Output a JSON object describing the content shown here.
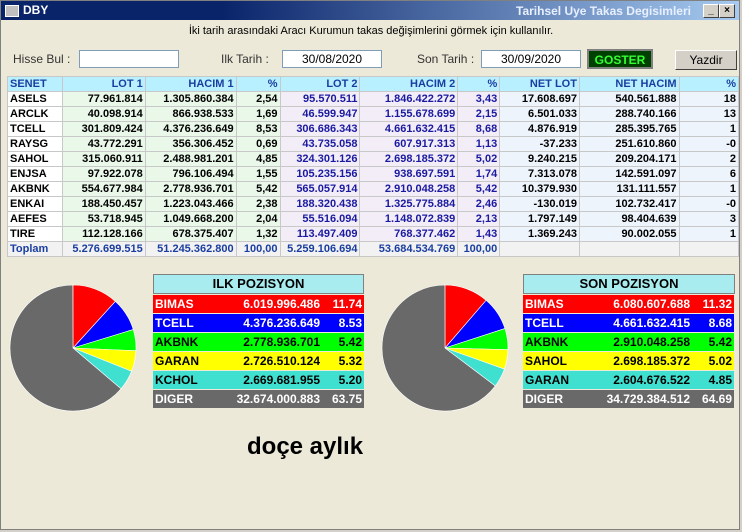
{
  "window": {
    "title": "DBY",
    "title_right": "Tarihsel Uye Takas Degisimleri"
  },
  "hint": "İki tarih arasındaki  Aracı Kurumun takas değişimlerini görmek için kullanılır.",
  "search": {
    "label": "Hisse Bul :",
    "value": ""
  },
  "dates": {
    "start_label": "Ilk Tarih :",
    "start_value": "30/08/2020",
    "end_label": "Son Tarih :",
    "end_value": "30/09/2020"
  },
  "buttons": {
    "show": "GOSTER",
    "print": "Yazdir"
  },
  "grid": {
    "headers": [
      "SENET",
      "LOT 1",
      "HACIM 1",
      "%",
      "LOT 2",
      "HACIM 2",
      "%",
      "NET LOT",
      "NET HACIM",
      "%"
    ],
    "rows": [
      [
        "ASELS",
        "77.961.814",
        "1.305.860.384",
        "2,54",
        "95.570.511",
        "1.846.422.272",
        "3,43",
        "17.608.697",
        "540.561.888",
        "18"
      ],
      [
        "ARCLK",
        "40.098.914",
        "866.938.533",
        "1,69",
        "46.599.947",
        "1.155.678.699",
        "2,15",
        "6.501.033",
        "288.740.166",
        "13"
      ],
      [
        "TCELL",
        "301.809.424",
        "4.376.236.649",
        "8,53",
        "306.686.343",
        "4.661.632.415",
        "8,68",
        "4.876.919",
        "285.395.765",
        "1"
      ],
      [
        "RAYSG",
        "43.772.291",
        "356.306.452",
        "0,69",
        "43.735.058",
        "607.917.313",
        "1,13",
        "-37.233",
        "251.610.860",
        "-0"
      ],
      [
        "SAHOL",
        "315.060.911",
        "2.488.981.201",
        "4,85",
        "324.301.126",
        "2.698.185.372",
        "5,02",
        "9.240.215",
        "209.204.171",
        "2"
      ],
      [
        "ENJSA",
        "97.922.078",
        "796.106.494",
        "1,55",
        "105.235.156",
        "938.697.591",
        "1,74",
        "7.313.078",
        "142.591.097",
        "6"
      ],
      [
        "AKBNK",
        "554.677.984",
        "2.778.936.701",
        "5,42",
        "565.057.914",
        "2.910.048.258",
        "5,42",
        "10.379.930",
        "131.111.557",
        "1"
      ],
      [
        "ENKAI",
        "188.450.457",
        "1.223.043.466",
        "2,38",
        "188.320.438",
        "1.325.775.884",
        "2,46",
        "-130.019",
        "102.732.417",
        "-0"
      ],
      [
        "AEFES",
        "53.718.945",
        "1.049.668.200",
        "2,04",
        "55.516.094",
        "1.148.072.839",
        "2,13",
        "1.797.149",
        "98.404.639",
        "3"
      ],
      [
        "TIRE",
        "112.128.166",
        "678.375.407",
        "1,32",
        "113.497.409",
        "768.377.462",
        "1,43",
        "1.369.243",
        "90.002.055",
        "1"
      ]
    ],
    "total": [
      "Toplam",
      "5.276.699.515",
      "51.245.362.800",
      "100,00",
      "5.259.106.694",
      "53.684.534.769",
      "100,00",
      "",
      "",
      ""
    ]
  },
  "ilk": {
    "title": "ILK POZISYON",
    "items": [
      {
        "name": "BIMAS",
        "value": "6.019.996.486",
        "pct": "11.74",
        "bg": "#ff0000",
        "fg": "#ffffff"
      },
      {
        "name": "TCELL",
        "value": "4.376.236.649",
        "pct": "8.53",
        "bg": "#0000ff",
        "fg": "#ffffff"
      },
      {
        "name": "AKBNK",
        "value": "2.778.936.701",
        "pct": "5.42",
        "bg": "#00ff00",
        "fg": "#000000"
      },
      {
        "name": "GARAN",
        "value": "2.726.510.124",
        "pct": "5.32",
        "bg": "#ffff00",
        "fg": "#000000"
      },
      {
        "name": "KCHOL",
        "value": "2.669.681.955",
        "pct": "5.20",
        "bg": "#40e0d0",
        "fg": "#000000"
      },
      {
        "name": "DIGER",
        "value": "32.674.000.883",
        "pct": "63.75",
        "bg": "#696969",
        "fg": "#ffffff"
      }
    ]
  },
  "son": {
    "title": "SON POZISYON",
    "items": [
      {
        "name": "BIMAS",
        "value": "6.080.607.688",
        "pct": "11.32",
        "bg": "#ff0000",
        "fg": "#ffffff"
      },
      {
        "name": "TCELL",
        "value": "4.661.632.415",
        "pct": "8.68",
        "bg": "#0000ff",
        "fg": "#ffffff"
      },
      {
        "name": "AKBNK",
        "value": "2.910.048.258",
        "pct": "5.42",
        "bg": "#00ff00",
        "fg": "#000000"
      },
      {
        "name": "SAHOL",
        "value": "2.698.185.372",
        "pct": "5.02",
        "bg": "#ffff00",
        "fg": "#000000"
      },
      {
        "name": "GARAN",
        "value": "2.604.676.522",
        "pct": "4.85",
        "bg": "#40e0d0",
        "fg": "#000000"
      },
      {
        "name": "DIGER",
        "value": "34.729.384.512",
        "pct": "64.69",
        "bg": "#696969",
        "fg": "#ffffff"
      }
    ]
  },
  "caption": "doçe aylık"
}
